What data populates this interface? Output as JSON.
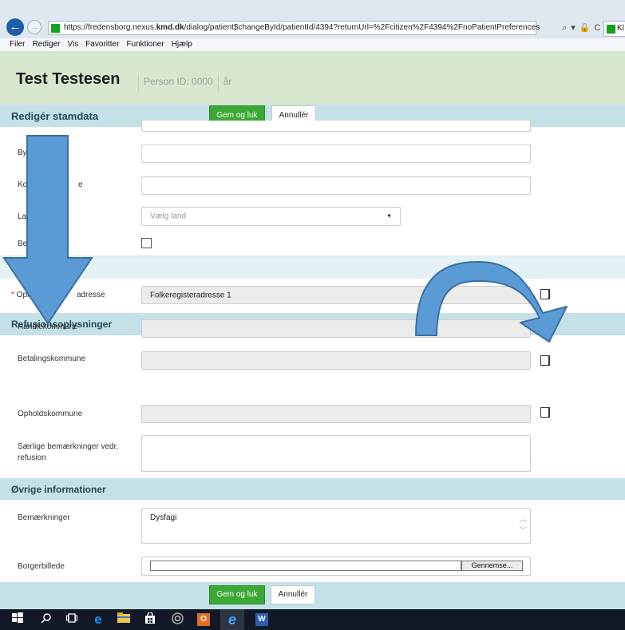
{
  "browser": {
    "url_prefix": "https://fredensborg.nexus.",
    "url_domain": "kmd.dk",
    "url_suffix": "/dialog/patient$changeById/patientId/4394?returnUrl=%2Fcitizen%2F4394%2FnoPatientPreferences",
    "tools": "⌕ ▾ 🔒 C",
    "tab_label": "Kl",
    "menu": [
      "Filer",
      "Rediger",
      "Vis",
      "Favoritter",
      "Funktioner",
      "Hjælp"
    ]
  },
  "patient": {
    "name": "Test Testesen",
    "person_id": "Person ID: 0000",
    "age": "år"
  },
  "dialog": {
    "title": "Redigér stamdata",
    "save_label": "Gem og luk",
    "cancel_label": "Annullér"
  },
  "form": {
    "by_label": "By",
    "kommune_label": "Ko",
    "kommune_label_tail": "e",
    "land_label": "La",
    "land_placeholder": "Vælg land",
    "be_label": "Be",
    "opholdsadresse_label": "Ophol",
    "opholdsadresse_label_tail": "adresse",
    "opholdsadresse_value": "Folkeregisteradresse 1"
  },
  "refusion": {
    "title": "Refusionsoplysninger",
    "handle_label": "Handlekommune",
    "betaling_label": "Betalingskommune",
    "ophold_label": "Opholdskommune",
    "saerlige_label_1": "Særlige bemærkninger vedr.",
    "saerlige_label_2": "refusion"
  },
  "oevrige": {
    "title": "Øvrige informationer",
    "bemaerk_label": "Bemærkninger",
    "bemaerk_value": "Dysfagi",
    "billede_label": "Borgerbillede",
    "browse_label": "Gennemse..."
  },
  "footer": {
    "save_label": "Gem og luk",
    "cancel_label": "Annullér"
  },
  "annotations": {
    "arrow_color": "#5b9bd5",
    "arrow_outline": "#3a6fa5"
  },
  "taskbar": {
    "word_label": "W",
    "outlook_label": "O"
  }
}
